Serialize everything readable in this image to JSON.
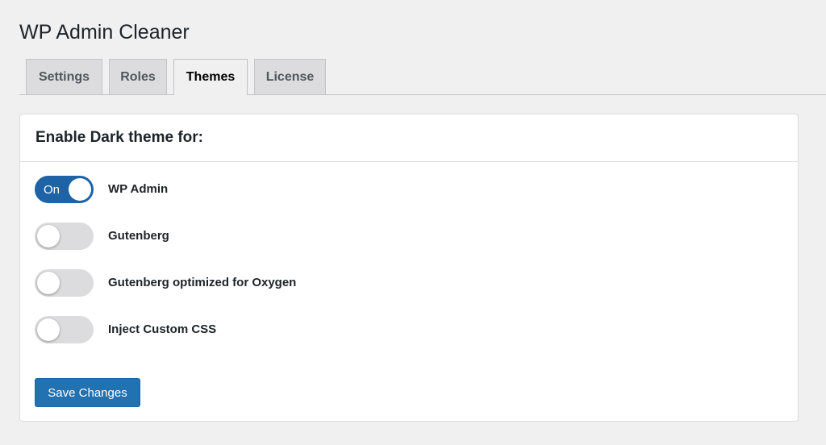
{
  "page": {
    "title": "WP Admin Cleaner"
  },
  "tabs": [
    {
      "label": "Settings",
      "active": false
    },
    {
      "label": "Roles",
      "active": false
    },
    {
      "label": "Themes",
      "active": true
    },
    {
      "label": "License",
      "active": false
    }
  ],
  "panel": {
    "title": "Enable Dark theme for:",
    "options": [
      {
        "label": "WP Admin",
        "state": "on",
        "toggle_text": "On"
      },
      {
        "label": "Gutenberg",
        "state": "off"
      },
      {
        "label": "Gutenberg optimized for Oxygen",
        "state": "off"
      },
      {
        "label": "Inject Custom CSS",
        "state": "off"
      }
    ]
  },
  "save_button": {
    "label": "Save Changes"
  },
  "colors": {
    "accent": "#2271b1",
    "toggle_on": "#1d63a6",
    "toggle_off": "#dcdcde",
    "background": "#f0f0f1"
  }
}
